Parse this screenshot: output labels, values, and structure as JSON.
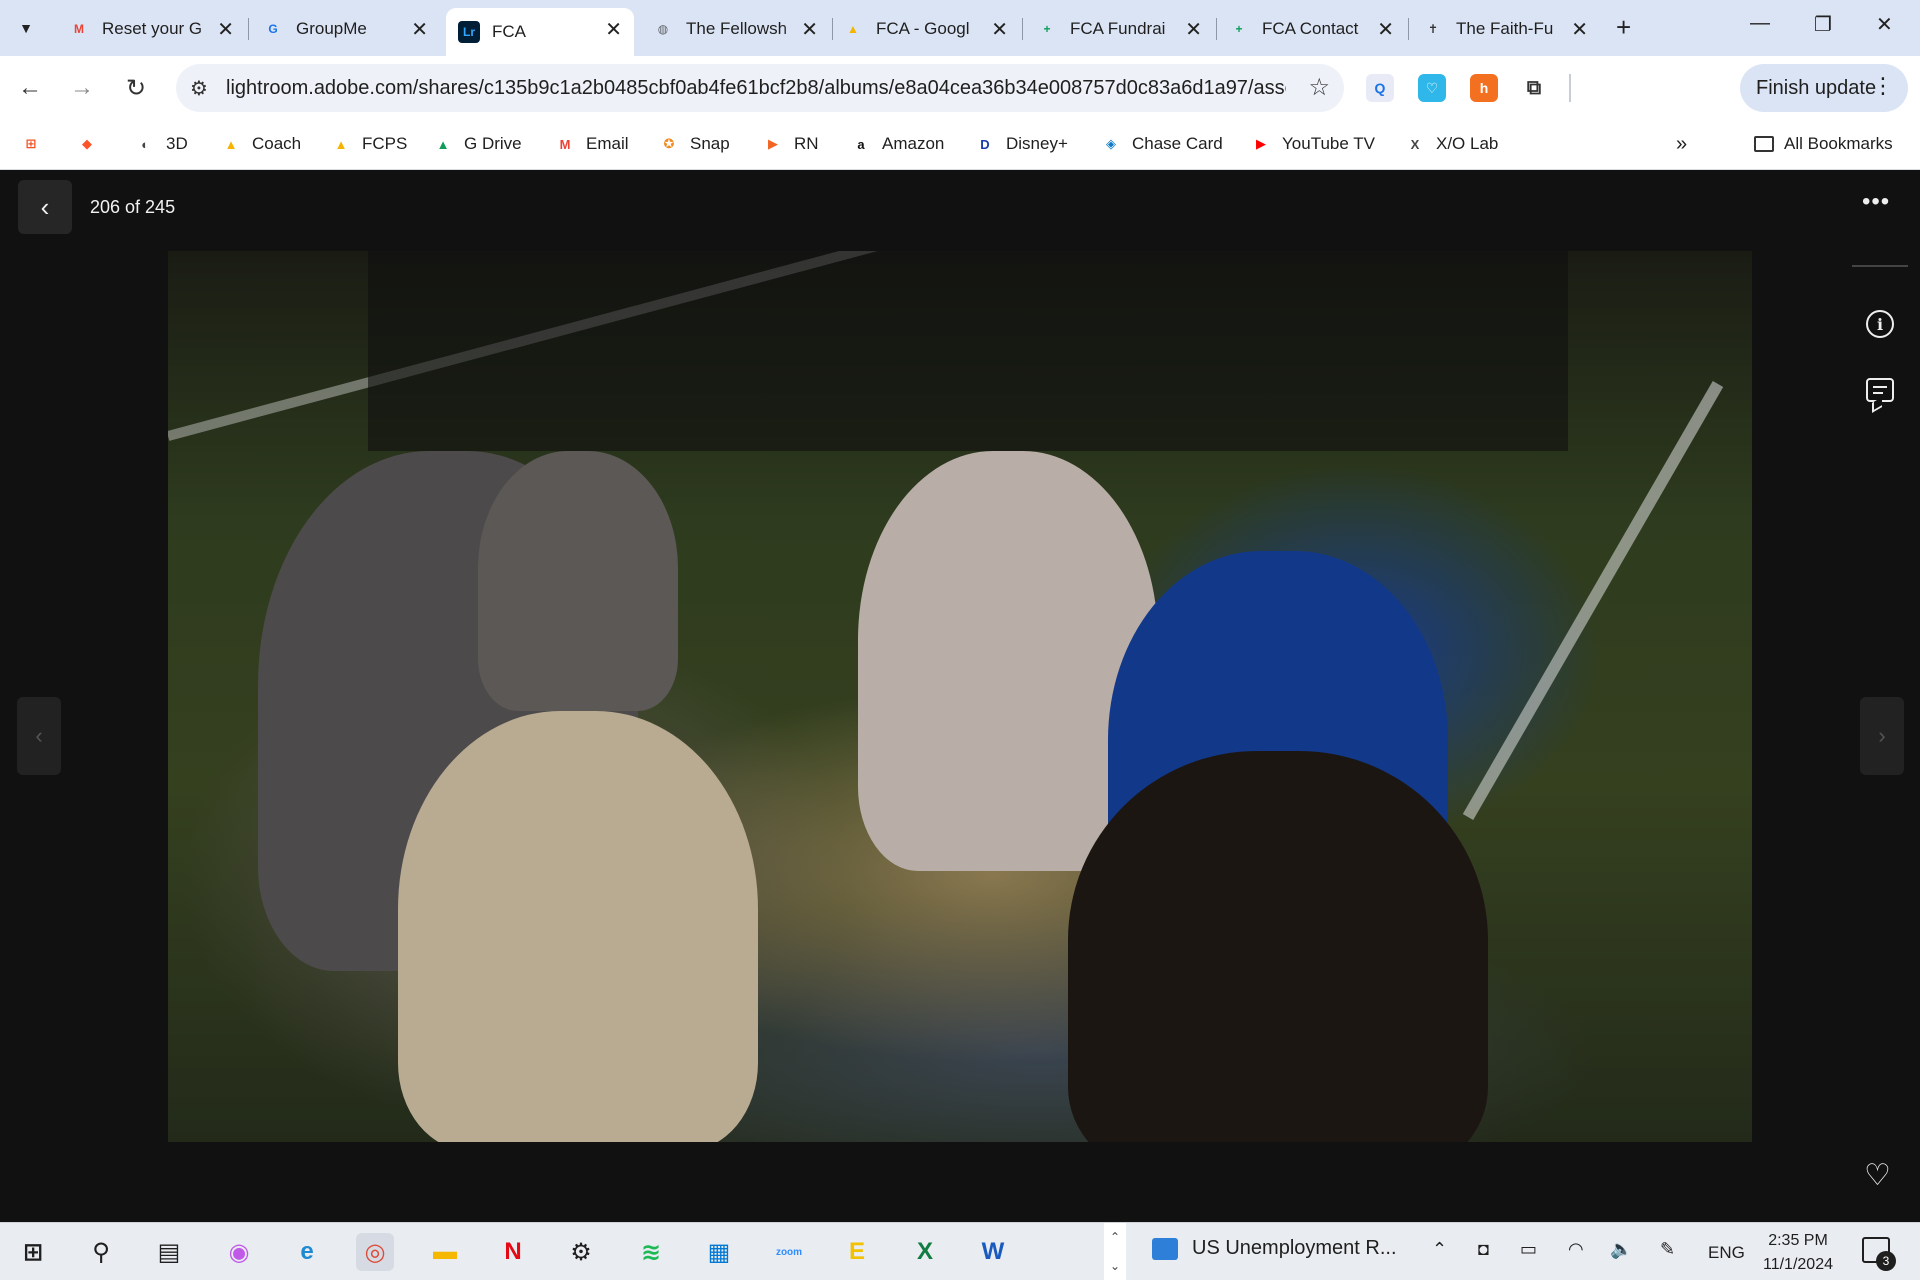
{
  "tabs": [
    {
      "title": "Reset your G",
      "favicon": "gmail-icon",
      "color": "#ea4335",
      "glyph": "M"
    },
    {
      "title": "GroupMe",
      "favicon": "groupme-icon",
      "color": "#1a73e8",
      "glyph": "G"
    },
    {
      "title": "FCA",
      "favicon": "lightroom-icon",
      "color": "#001e36",
      "glyph": "Lr",
      "active": true
    },
    {
      "title": "The Fellowsh",
      "favicon": "globe-icon",
      "color": "#5f6368",
      "glyph": "◍"
    },
    {
      "title": "FCA - Googl",
      "favicon": "google-drive-icon",
      "color": "#f4b400",
      "glyph": "▲"
    },
    {
      "title": "FCA Fundrai",
      "favicon": "google-sheets-icon",
      "color": "#0f9d58",
      "glyph": "+"
    },
    {
      "title": "FCA Contact",
      "favicon": "google-sheets-icon",
      "color": "#0f9d58",
      "glyph": "+"
    },
    {
      "title": "The Faith-Fu",
      "favicon": "fca-logo-icon",
      "color": "#333333",
      "glyph": "✝"
    }
  ],
  "address": {
    "url": "lightroom.adobe.com/shares/c135b9c1a2b0485cbf0ab4fe61bcf2b8/albums/e8a04cea36b34e008757d0c83a6d1a97/asse..."
  },
  "finish_update": "Finish update",
  "bookmarks": [
    {
      "label": "",
      "icon": "windows-icon",
      "color": "#f25022",
      "glyph": "⊞"
    },
    {
      "label": "",
      "icon": "brave-icon",
      "color": "#fb542b",
      "glyph": "◆"
    },
    {
      "label": "3D",
      "icon": "3d-icon",
      "color": "#444444",
      "glyph": "◐"
    },
    {
      "label": "Coach",
      "icon": "google-drive-icon",
      "color": "#f4b400",
      "glyph": "▲"
    },
    {
      "label": "FCPS",
      "icon": "google-drive-icon",
      "color": "#f4b400",
      "glyph": "▲"
    },
    {
      "label": "G Drive",
      "icon": "google-drive-icon",
      "color": "#0f9d58",
      "glyph": "▲"
    },
    {
      "label": "Email",
      "icon": "gmail-icon",
      "color": "#ea4335",
      "glyph": "M"
    },
    {
      "label": "Snap",
      "icon": "snap-icon",
      "color": "#f08a24",
      "glyph": "✪"
    },
    {
      "label": "RN",
      "icon": "rn-icon",
      "color": "#f26522",
      "glyph": "▶"
    },
    {
      "label": "Amazon",
      "icon": "amazon-icon",
      "color": "#111111",
      "glyph": "a"
    },
    {
      "label": "Disney+",
      "icon": "disney-icon",
      "color": "#1a3ca8",
      "glyph": "D"
    },
    {
      "label": "Chase Card",
      "icon": "chase-icon",
      "color": "#117aca",
      "glyph": "◈"
    },
    {
      "label": "YouTube TV",
      "icon": "youtube-tv-icon",
      "color": "#ff0000",
      "glyph": "▶"
    },
    {
      "label": "X/O Lab",
      "icon": "xo-lab-icon",
      "color": "#444444",
      "glyph": "X"
    }
  ],
  "all_bookmarks": "All Bookmarks",
  "viewer": {
    "counter": "206 of 245",
    "more": "•••"
  },
  "taskbar": {
    "weather": "US Unemployment R...",
    "lang": "ENG",
    "time": "2:35 PM",
    "date": "11/1/2024",
    "notif_count": "3",
    "apps": [
      {
        "name": "start-icon",
        "color": "#1f1f1f",
        "glyph": "⊞"
      },
      {
        "name": "search-icon",
        "color": "#1f1f1f",
        "glyph": "⚲"
      },
      {
        "name": "task-view-icon",
        "color": "#1f1f1f",
        "glyph": "▤"
      },
      {
        "name": "copilot-icon",
        "color": "#c159e8",
        "glyph": "◉"
      },
      {
        "name": "edge-icon",
        "color": "#1f8ad2",
        "glyph": "e"
      },
      {
        "name": "chrome-icon",
        "color": "#dd4b39",
        "glyph": "◎",
        "active": true
      },
      {
        "name": "file-explorer-icon",
        "color": "#f6b700",
        "glyph": "▬"
      },
      {
        "name": "netflix-icon",
        "color": "#e50914",
        "glyph": "N"
      },
      {
        "name": "settings-icon",
        "color": "#1f1f1f",
        "glyph": "⚙"
      },
      {
        "name": "spotify-icon",
        "color": "#1db954",
        "glyph": "≋"
      },
      {
        "name": "store-icon",
        "color": "#0078d4",
        "glyph": "▦"
      },
      {
        "name": "zoom-icon",
        "color": "#2d8cff",
        "glyph": "zoom"
      },
      {
        "name": "edge-game-icon",
        "color": "#f2c200",
        "glyph": "E"
      },
      {
        "name": "excel-icon",
        "color": "#107c41",
        "glyph": "X"
      },
      {
        "name": "word-icon",
        "color": "#185abd",
        "glyph": "W"
      }
    ]
  }
}
